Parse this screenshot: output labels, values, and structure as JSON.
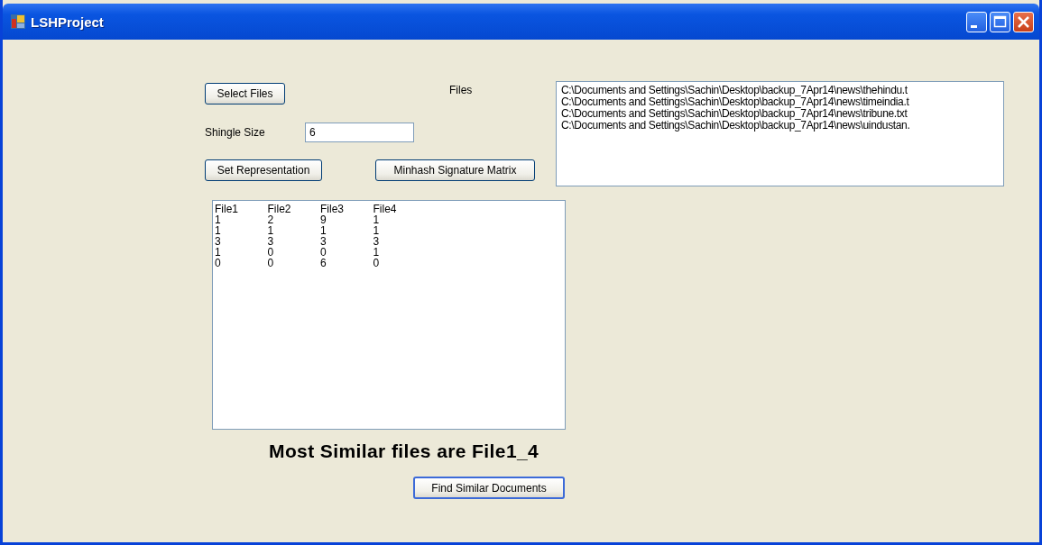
{
  "window": {
    "title": "LSHProject"
  },
  "select_files_button": "Select Files",
  "files_label": "Files",
  "files_list": [
    "C:\\Documents and Settings\\Sachin\\Desktop\\backup_7Apr14\\news\\thehindu.t",
    "C:\\Documents and Settings\\Sachin\\Desktop\\backup_7Apr14\\news\\timeindia.t",
    "C:\\Documents and Settings\\Sachin\\Desktop\\backup_7Apr14\\news\\tribune.txt",
    "C:\\Documents and Settings\\Sachin\\Desktop\\backup_7Apr14\\news\\uindustan."
  ],
  "shingle_size": {
    "label": "Shingle Size",
    "value": "6"
  },
  "set_representation_button": "Set Representation",
  "minhash_button": "Minhash Signature Matrix",
  "matrix": {
    "columns": [
      "File1",
      "File2",
      "File3",
      "File4"
    ],
    "rows": [
      [
        "1",
        "2",
        "9",
        "1"
      ],
      [
        "1",
        "1",
        "1",
        "1"
      ],
      [
        "3",
        "3",
        "3",
        "3"
      ],
      [
        "1",
        "0",
        "0",
        "1"
      ],
      [
        "0",
        "0",
        "6",
        "0"
      ]
    ]
  },
  "result": "Most Similar files are File1_4",
  "find_button": "Find Similar Documents"
}
